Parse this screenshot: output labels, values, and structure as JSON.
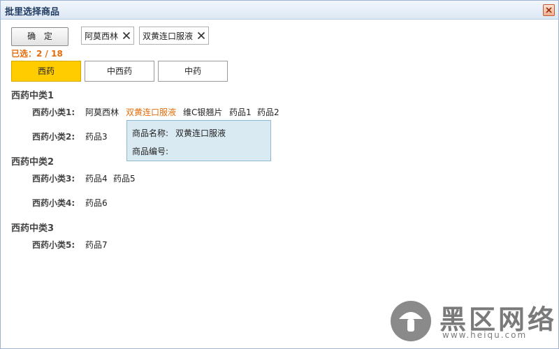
{
  "window": {
    "title": "批里选择商品"
  },
  "toolbar": {
    "confirm_label": "确 定",
    "selected_text": "已选：2 / 18"
  },
  "chips": [
    {
      "label": "阿莫西林"
    },
    {
      "label": "双黄连口服液"
    }
  ],
  "tabs": [
    {
      "label": "西药",
      "active": true
    },
    {
      "label": "中西药",
      "active": false
    },
    {
      "label": "中药",
      "active": false
    }
  ],
  "categories": [
    {
      "title": "西药中类1",
      "subcategories": [
        {
          "label": "西药小类1:",
          "items": [
            "阿莫西林",
            "双黄连口服液",
            "维C银翘片",
            "药品1",
            "药品2"
          ]
        },
        {
          "label": "西药小类2:",
          "items": [
            "药品3"
          ]
        }
      ]
    },
    {
      "title": "西药中类2",
      "subcategories": [
        {
          "label": "西药小类3:",
          "items": [
            "药品4",
            "药品5"
          ]
        },
        {
          "label": "西药小类4:",
          "items": [
            "药品6"
          ]
        }
      ]
    },
    {
      "title": "西药中类3",
      "subcategories": [
        {
          "label": "西药小类5:",
          "items": [
            "药品7"
          ]
        }
      ]
    }
  ],
  "tooltip": {
    "name_label": "商品名称:",
    "name_value": "双黄连口服液",
    "code_label": "商品编号:",
    "code_value": ""
  },
  "watermark": {
    "brand": "黑区网络",
    "url": "www.heiqu.com"
  },
  "colors": {
    "highlight": "#e46c0a",
    "active_tab": "#ffcc00",
    "tooltip_bg": "#d9eaf3"
  },
  "icons": {
    "close": "close-icon",
    "chip_remove": "x-icon"
  }
}
